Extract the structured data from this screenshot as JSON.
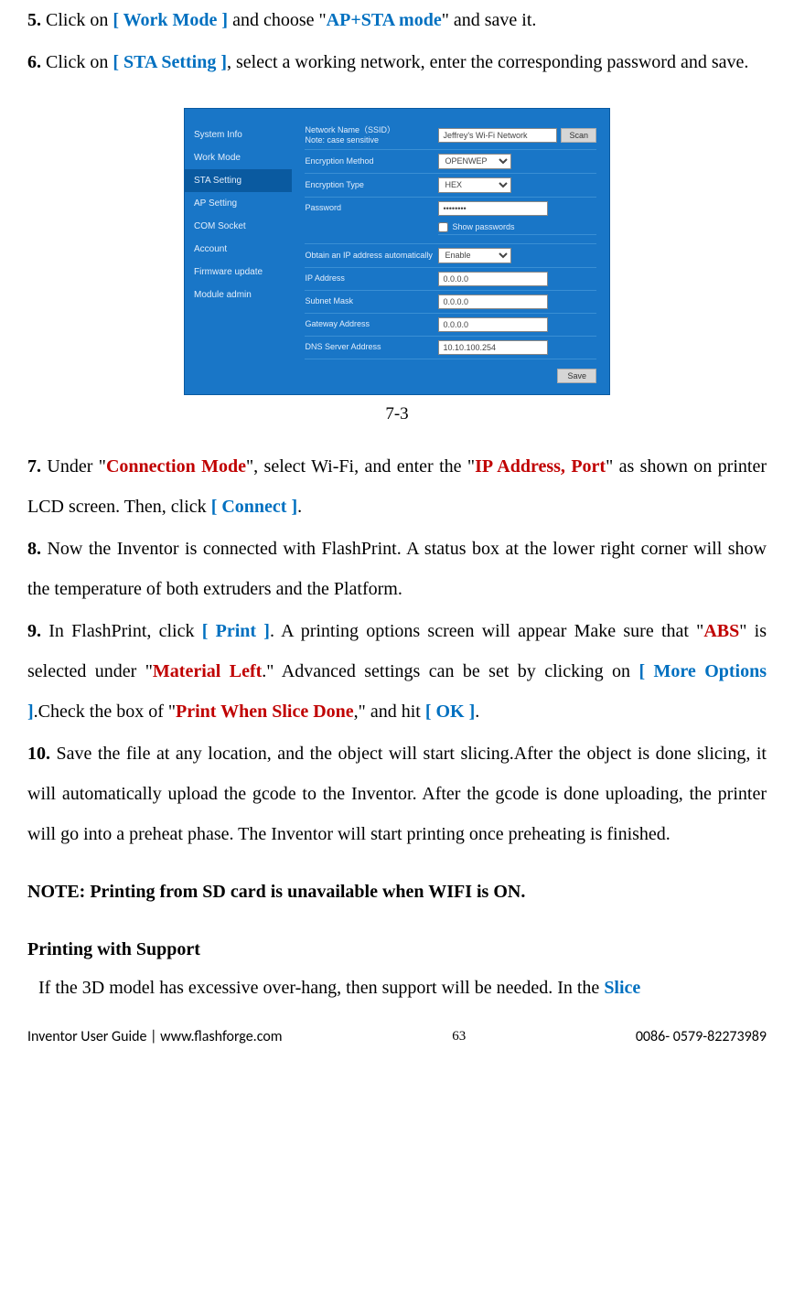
{
  "steps": {
    "s5": {
      "num": "5.",
      "pre": " Click on ",
      "link": "[ Work Mode ]",
      "mid": " and choose \"",
      "mode": "AP+STA mode",
      "post": "\" and save it."
    },
    "s6": {
      "num": "6.",
      "pre": " Click on ",
      "link": "[ STA Setting ]",
      "post": ", select a working network, enter the corresponding password and save."
    },
    "s7": {
      "num": "7.",
      "pre": " Under \"",
      "red1": "Connection Mode",
      "mid1": "\", select Wi-Fi, and enter the \"",
      "red2": "IP Address, Port",
      "mid2": "\" as shown on printer LCD screen. Then, click ",
      "link": "[ Connect ]",
      "post": "."
    },
    "s8": {
      "num": "8.",
      "text": " Now the Inventor is connected with FlashPrint. A status box at the lower right corner will show the temperature of both extruders and the Platform."
    },
    "s9": {
      "num": "9.",
      "pre": " In FlashPrint, click ",
      "link1": "[ Print ]",
      "mid1": ". A printing options screen will appear Make sure that \"",
      "red1": "ABS",
      "mid2": "\" is selected under \"",
      "red2": "Material Left",
      "mid3": ".\" Advanced settings can be set by clicking on ",
      "link2": "[ More Options ]",
      "mid4": ".Check the box of \"",
      "red3": "Print When Slice Done",
      "mid5": ",\" and hit ",
      "link3": "[ OK ]",
      "post": "."
    },
    "s10": {
      "num": "10.",
      "text": " Save the file at any location, and the object will start slicing.After the object is done slicing, it will automatically upload the gcode to the Inventor. After the gcode is done uploading, the printer will go into a preheat phase. The Inventor will start printing once preheating is finished."
    }
  },
  "caption": "7-3",
  "note": "NOTE: Printing from SD card is unavailable when WIFI is ON.",
  "support_heading": "Printing with Support",
  "support_para_pre": "If the 3D model has excessive over-hang, then support will be needed. In the ",
  "support_para_blue": "Slice",
  "shot": {
    "sidebar": [
      "System Info",
      "Work Mode",
      "STA Setting",
      "AP Setting",
      "COM Socket",
      "Account",
      "Firmware update",
      "Module admin"
    ],
    "active_index": 2,
    "fields": {
      "ssid_label": "Network Name（SSID）\nNote: case sensitive",
      "ssid_value": "Jeffrey's Wi-Fi Network",
      "scan": "Scan",
      "enc_method_label": "Encryption Method",
      "enc_method_value": "OPENWEP",
      "enc_type_label": "Encryption Type",
      "enc_type_value": "HEX",
      "password_label": "Password",
      "password_value": "••••••••",
      "show_pw": "Show passwords",
      "obtain_ip_label": "Obtain an IP address automatically",
      "obtain_ip_value": "Enable",
      "ip_label": "IP Address",
      "ip_value": "0.0.0.0",
      "subnet_label": "Subnet Mask",
      "subnet_value": "0.0.0.0",
      "gateway_label": "Gateway Address",
      "gateway_value": "0.0.0.0",
      "dns_label": "DNS Server Address",
      "dns_value": "10.10.100.254",
      "save": "Save"
    }
  },
  "footer": {
    "left": "Inventor User Guide | www.flashforge.com",
    "page": "63",
    "right": "0086- 0579-82273989"
  }
}
